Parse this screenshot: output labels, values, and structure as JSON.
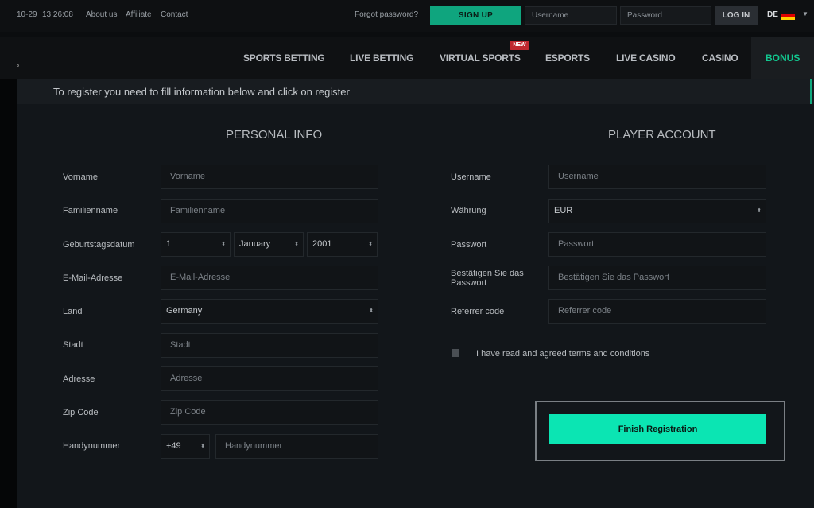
{
  "topbar": {
    "date": "10-29",
    "time": "13:26:08",
    "links": [
      "About us",
      "Affiliate",
      "Contact"
    ],
    "forgot_password": "Forgot password?",
    "sign_up": "SIGN UP",
    "username_placeholder": "Username",
    "password_placeholder": "Password",
    "log_in": "LOG IN",
    "language": "DE"
  },
  "nav": {
    "items": [
      "SPORTS BETTING",
      "LIVE BETTING",
      "VIRTUAL SPORTS",
      "ESPORTS",
      "LIVE CASINO",
      "CASINO",
      "BONUS"
    ],
    "new_badge": "NEW",
    "active": "BONUS"
  },
  "banner": "To register you need to fill information below and click on register",
  "personal": {
    "title": "PERSONAL INFO",
    "first_name": {
      "label": "Vorname",
      "placeholder": "Vorname"
    },
    "last_name": {
      "label": "Familienname",
      "placeholder": "Familienname"
    },
    "birthdate": {
      "label": "Geburtstagsdatum",
      "day": "1",
      "month": "January",
      "year": "2001"
    },
    "email": {
      "label": "E-Mail-Adresse",
      "placeholder": "E-Mail-Adresse"
    },
    "country": {
      "label": "Land",
      "value": "Germany"
    },
    "city": {
      "label": "Stadt",
      "placeholder": "Stadt"
    },
    "address": {
      "label": "Adresse",
      "placeholder": "Adresse"
    },
    "zip": {
      "label": "Zip Code",
      "placeholder": "Zip Code"
    },
    "phone": {
      "label": "Handynummer",
      "prefix": "+49",
      "placeholder": "Handynummer"
    }
  },
  "account": {
    "title": "PLAYER ACCOUNT",
    "username": {
      "label": "Username",
      "placeholder": "Username"
    },
    "currency": {
      "label": "Währung",
      "value": "EUR"
    },
    "password": {
      "label": "Passwort",
      "placeholder": "Passwort"
    },
    "confirm": {
      "label_line1": "Bestätigen Sie das",
      "label_line2": "Passwort",
      "placeholder": "Bestätigen Sie das Passwort"
    },
    "referrer": {
      "label": "Referrer code",
      "placeholder": "Referrer code"
    },
    "terms": "I have read and agreed terms and conditions",
    "finish": "Finish Registration"
  },
  "colors": {
    "accent": "#0be5b3",
    "signup": "#0fa57e",
    "new_badge": "#c0282f"
  }
}
